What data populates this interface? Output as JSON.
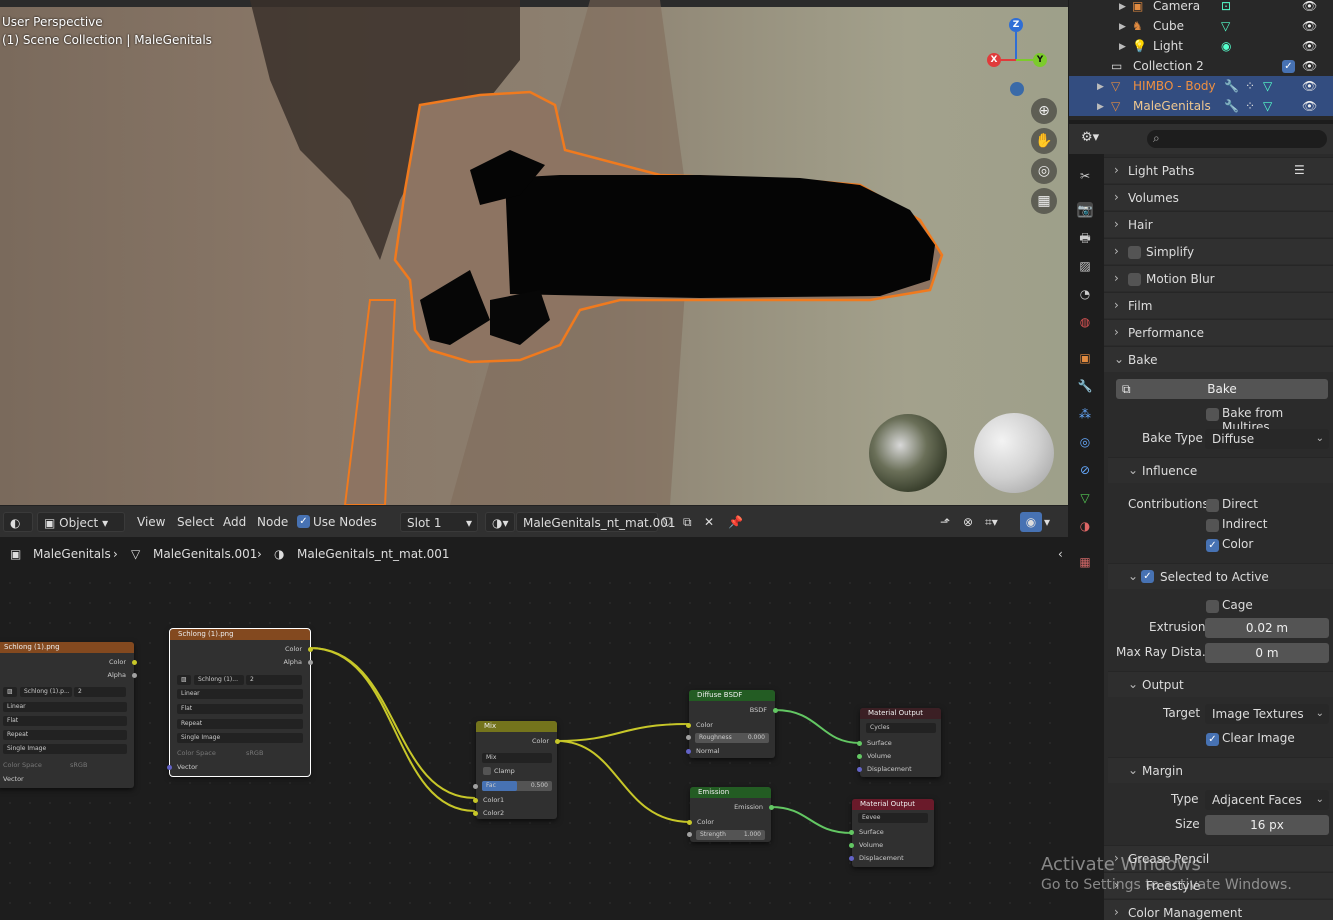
{
  "viewport": {
    "mode": "User Perspective",
    "collection": "(1) Scene Collection | MaleGenitals",
    "gizmo": {
      "z": "Z",
      "x": "X",
      "y": "Y"
    }
  },
  "node_header": {
    "editor_type": "Object",
    "menu": [
      "View",
      "Select",
      "Add",
      "Node"
    ],
    "use_nodes": "Use Nodes",
    "slot": "Slot 1",
    "material": "MaleGenitals_nt_mat.001"
  },
  "breadcrumb": {
    "object": "MaleGenitals",
    "mesh": "MaleGenitals.001",
    "material": "MaleGenitals_nt_mat.001"
  },
  "nodes": {
    "img1": {
      "title": "Schlong (1).png",
      "out_color": "Color",
      "out_alpha": "Alpha",
      "image": "Schlong (1).p...",
      "users": "2",
      "interp": "Linear",
      "proj": "Flat",
      "ext": "Repeat",
      "source": "Single Image",
      "cs_label": "Color Space",
      "cs_value": "sRGB",
      "vector": "Vector"
    },
    "img2": {
      "title": "Schlong (1).png",
      "out_color": "Color",
      "out_alpha": "Alpha",
      "image": "Schlong (1)...",
      "users": "2",
      "interp": "Linear",
      "proj": "Flat",
      "ext": "Repeat",
      "source": "Single Image",
      "cs_label": "Color Space",
      "cs_value": "sRGB",
      "vector": "Vector"
    },
    "mix": {
      "title": "Mix",
      "out": "Color",
      "mode": "Mix",
      "clamp": "Clamp",
      "fac_label": "Fac",
      "fac": "0.500",
      "c1": "Color1",
      "c2": "Color2"
    },
    "diffuse": {
      "title": "Diffuse BSDF",
      "out": "BSDF",
      "color": "Color",
      "rough_label": "Roughness",
      "rough": "0.000",
      "normal": "Normal"
    },
    "emission": {
      "title": "Emission",
      "out": "Emission",
      "color": "Color",
      "str_label": "Strength",
      "str": "1.000"
    },
    "out_cycles": {
      "title": "Material Output",
      "target": "Cycles",
      "surface": "Surface",
      "volume": "Volume",
      "disp": "Displacement"
    },
    "out_eevee": {
      "title": "Material Output",
      "target": "Eevee",
      "surface": "Surface",
      "volume": "Volume",
      "disp": "Displacement"
    }
  },
  "outliner": {
    "items": [
      {
        "name": "Camera"
      },
      {
        "name": "Cube"
      },
      {
        "name": "Light"
      },
      {
        "name": "Collection 2"
      },
      {
        "name": "HIMBO - Body"
      },
      {
        "name": "MaleGenitals"
      }
    ]
  },
  "props": {
    "panels": [
      "Light Paths",
      "Volumes",
      "Hair",
      "Simplify",
      "Motion Blur",
      "Film",
      "Performance",
      "Bake"
    ],
    "bake_button": "Bake",
    "bake_from_multires": "Bake from Multires",
    "bake_type_label": "Bake Type",
    "bake_type": "Diffuse",
    "influence": "Influence",
    "contributions": "Contributions",
    "direct": "Direct",
    "indirect": "Indirect",
    "color": "Color",
    "selected_to_active": "Selected to Active",
    "cage": "Cage",
    "extrusion_label": "Extrusion",
    "extrusion": "0.02 m",
    "max_ray_label": "Max Ray Dista...",
    "max_ray": "0 m",
    "output": "Output",
    "target_label": "Target",
    "target": "Image Textures",
    "clear_image": "Clear Image",
    "margin": "Margin",
    "type_label": "Type",
    "type": "Adjacent Faces",
    "size_label": "Size",
    "size": "16 px",
    "bottom_panels": [
      "Grease Pencil",
      "Freestyle",
      "Color Management"
    ]
  },
  "watermark": {
    "line1": "Activate Windows",
    "line2": "Go to Settings to activate Windows."
  }
}
